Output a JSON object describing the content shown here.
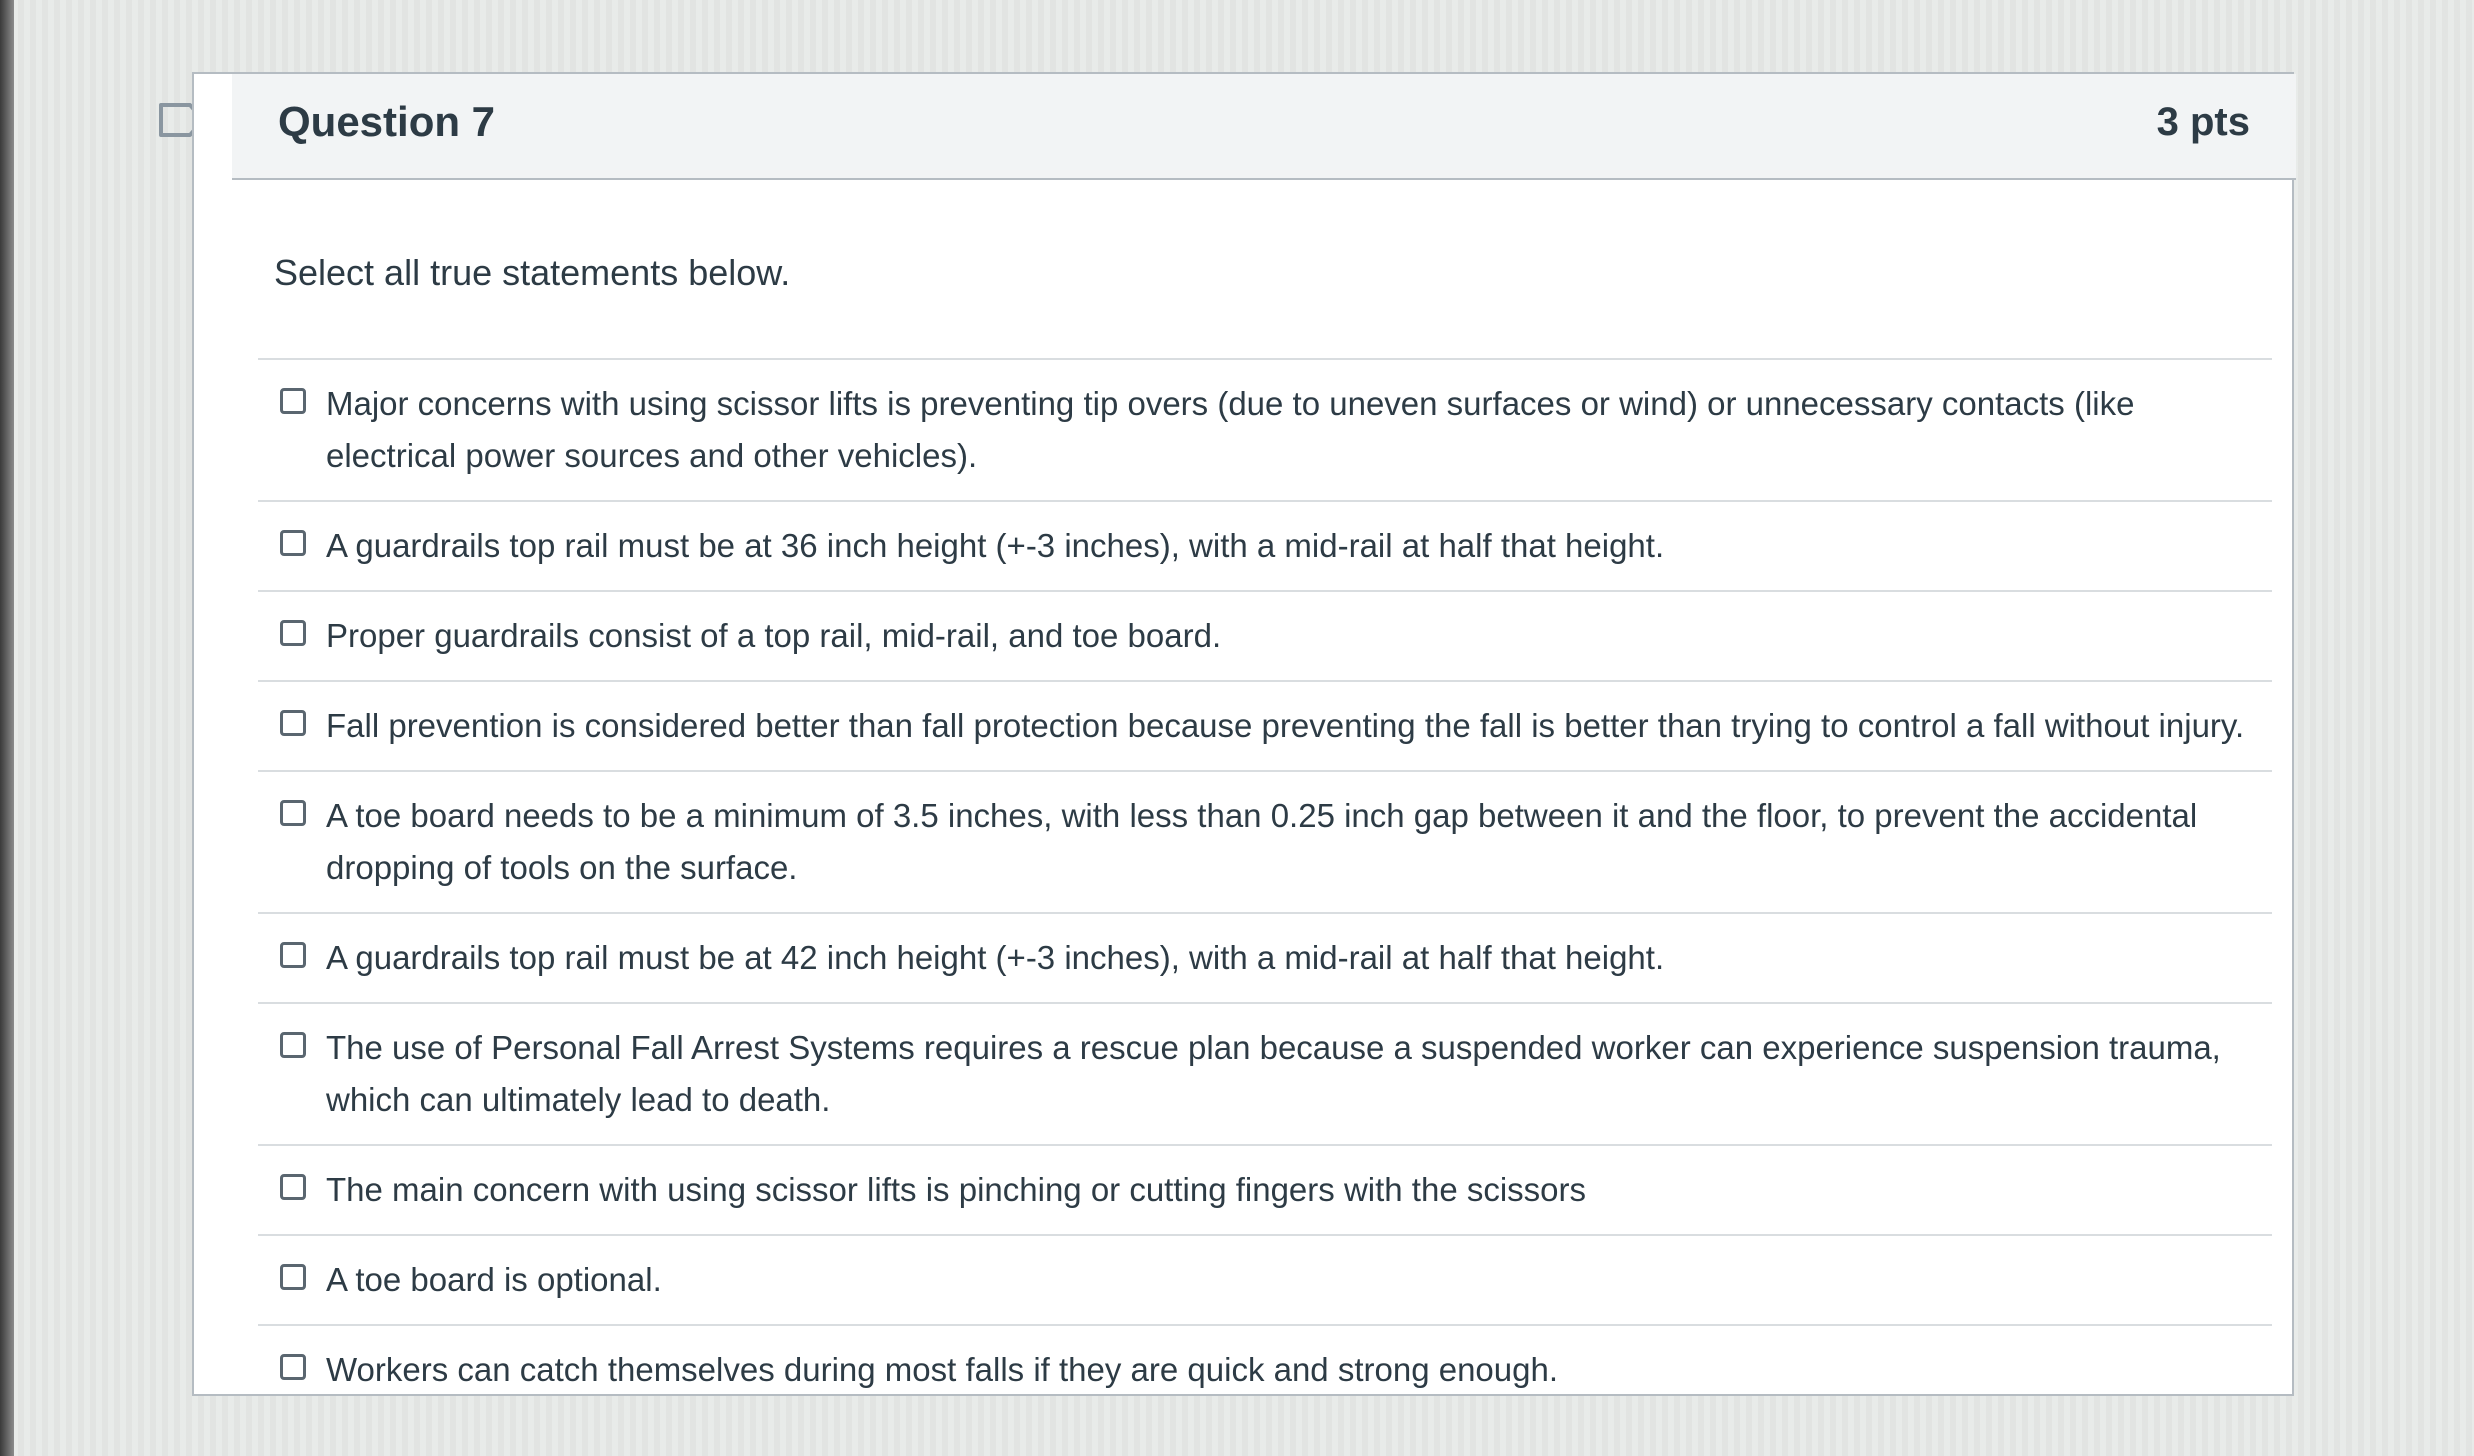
{
  "question": {
    "title": "Question 7",
    "points": "3 pts",
    "prompt": "Select all true statements below.",
    "flag_icon": "bookmark-flag-icon"
  },
  "answers": [
    {
      "label": "Major concerns with using scissor lifts is preventing tip overs (due to uneven surfaces or wind) or unnecessary contacts (like electrical power sources and other vehicles).",
      "checked": false
    },
    {
      "label": "A guardrails top rail must be at 36 inch height (+-3 inches), with a mid-rail at half that height.",
      "checked": false
    },
    {
      "label": "Proper guardrails consist of a top rail, mid-rail, and toe board.",
      "checked": false
    },
    {
      "label": "Fall prevention is considered better than fall protection because preventing the fall is better than trying to control a fall without injury.",
      "checked": false
    },
    {
      "label": "A toe board needs to be a minimum of 3.5 inches, with less than 0.25 inch gap between it and the floor, to prevent the accidental dropping of tools on the surface.",
      "checked": false
    },
    {
      "label": "A guardrails top rail must be at 42 inch height (+-3 inches), with a mid-rail at half that height.",
      "checked": false
    },
    {
      "label": "The use of Personal Fall Arrest Systems requires a rescue plan because a suspended worker can experience suspension trauma, which can ultimately lead to death.",
      "checked": false
    },
    {
      "label": "The main concern with using scissor lifts is pinching or cutting fingers with the scissors",
      "checked": false
    },
    {
      "label": "A toe board is optional.",
      "checked": false
    },
    {
      "label": "Workers can catch themselves during most falls if they are quick and strong enough.",
      "checked": false
    }
  ],
  "colors": {
    "text": "#2d3b45",
    "header_bg": "#f2f4f5",
    "border": "#b5bcc2",
    "divider": "#d9dde0"
  }
}
